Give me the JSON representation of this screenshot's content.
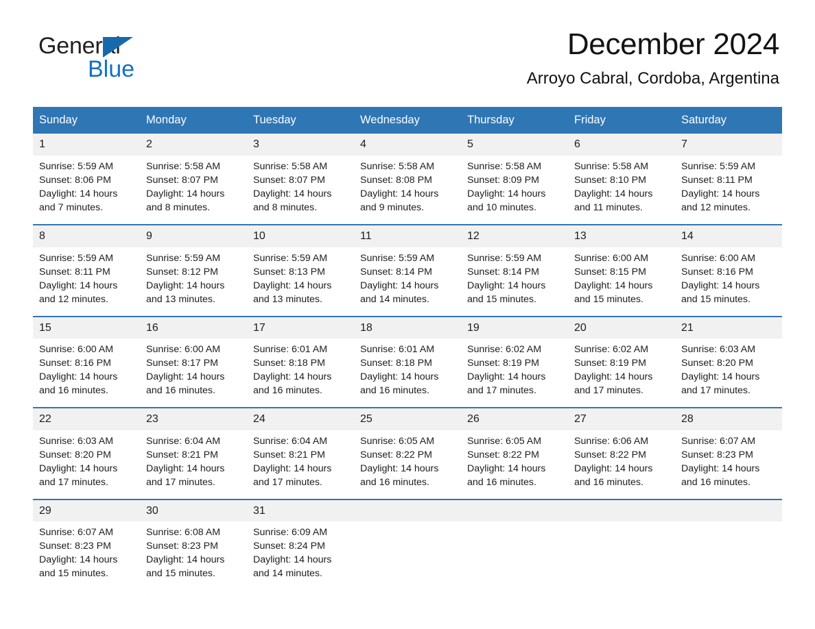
{
  "brand": {
    "name_part1": "General",
    "name_part2": "Blue",
    "logo_icon": "triangle-logo-icon",
    "accent_color": "#1271c4"
  },
  "header": {
    "month_title": "December 2024",
    "location": "Arroyo Cabral, Cordoba, Argentina"
  },
  "theme": {
    "header_blue": "#2f76b5",
    "daynum_band": "#f1f1f1",
    "text": "#1c1c1c"
  },
  "calendar": {
    "day_headers": [
      "Sunday",
      "Monday",
      "Tuesday",
      "Wednesday",
      "Thursday",
      "Friday",
      "Saturday"
    ],
    "weeks": [
      [
        {
          "day": "1",
          "sunrise": "Sunrise: 5:59 AM",
          "sunset": "Sunset: 8:06 PM",
          "daylight_line1": "Daylight: 14 hours",
          "daylight_line2": "and 7 minutes."
        },
        {
          "day": "2",
          "sunrise": "Sunrise: 5:58 AM",
          "sunset": "Sunset: 8:07 PM",
          "daylight_line1": "Daylight: 14 hours",
          "daylight_line2": "and 8 minutes."
        },
        {
          "day": "3",
          "sunrise": "Sunrise: 5:58 AM",
          "sunset": "Sunset: 8:07 PM",
          "daylight_line1": "Daylight: 14 hours",
          "daylight_line2": "and 8 minutes."
        },
        {
          "day": "4",
          "sunrise": "Sunrise: 5:58 AM",
          "sunset": "Sunset: 8:08 PM",
          "daylight_line1": "Daylight: 14 hours",
          "daylight_line2": "and 9 minutes."
        },
        {
          "day": "5",
          "sunrise": "Sunrise: 5:58 AM",
          "sunset": "Sunset: 8:09 PM",
          "daylight_line1": "Daylight: 14 hours",
          "daylight_line2": "and 10 minutes."
        },
        {
          "day": "6",
          "sunrise": "Sunrise: 5:58 AM",
          "sunset": "Sunset: 8:10 PM",
          "daylight_line1": "Daylight: 14 hours",
          "daylight_line2": "and 11 minutes."
        },
        {
          "day": "7",
          "sunrise": "Sunrise: 5:59 AM",
          "sunset": "Sunset: 8:11 PM",
          "daylight_line1": "Daylight: 14 hours",
          "daylight_line2": "and 12 minutes."
        }
      ],
      [
        {
          "day": "8",
          "sunrise": "Sunrise: 5:59 AM",
          "sunset": "Sunset: 8:11 PM",
          "daylight_line1": "Daylight: 14 hours",
          "daylight_line2": "and 12 minutes."
        },
        {
          "day": "9",
          "sunrise": "Sunrise: 5:59 AM",
          "sunset": "Sunset: 8:12 PM",
          "daylight_line1": "Daylight: 14 hours",
          "daylight_line2": "and 13 minutes."
        },
        {
          "day": "10",
          "sunrise": "Sunrise: 5:59 AM",
          "sunset": "Sunset: 8:13 PM",
          "daylight_line1": "Daylight: 14 hours",
          "daylight_line2": "and 13 minutes."
        },
        {
          "day": "11",
          "sunrise": "Sunrise: 5:59 AM",
          "sunset": "Sunset: 8:14 PM",
          "daylight_line1": "Daylight: 14 hours",
          "daylight_line2": "and 14 minutes."
        },
        {
          "day": "12",
          "sunrise": "Sunrise: 5:59 AM",
          "sunset": "Sunset: 8:14 PM",
          "daylight_line1": "Daylight: 14 hours",
          "daylight_line2": "and 15 minutes."
        },
        {
          "day": "13",
          "sunrise": "Sunrise: 6:00 AM",
          "sunset": "Sunset: 8:15 PM",
          "daylight_line1": "Daylight: 14 hours",
          "daylight_line2": "and 15 minutes."
        },
        {
          "day": "14",
          "sunrise": "Sunrise: 6:00 AM",
          "sunset": "Sunset: 8:16 PM",
          "daylight_line1": "Daylight: 14 hours",
          "daylight_line2": "and 15 minutes."
        }
      ],
      [
        {
          "day": "15",
          "sunrise": "Sunrise: 6:00 AM",
          "sunset": "Sunset: 8:16 PM",
          "daylight_line1": "Daylight: 14 hours",
          "daylight_line2": "and 16 minutes."
        },
        {
          "day": "16",
          "sunrise": "Sunrise: 6:00 AM",
          "sunset": "Sunset: 8:17 PM",
          "daylight_line1": "Daylight: 14 hours",
          "daylight_line2": "and 16 minutes."
        },
        {
          "day": "17",
          "sunrise": "Sunrise: 6:01 AM",
          "sunset": "Sunset: 8:18 PM",
          "daylight_line1": "Daylight: 14 hours",
          "daylight_line2": "and 16 minutes."
        },
        {
          "day": "18",
          "sunrise": "Sunrise: 6:01 AM",
          "sunset": "Sunset: 8:18 PM",
          "daylight_line1": "Daylight: 14 hours",
          "daylight_line2": "and 16 minutes."
        },
        {
          "day": "19",
          "sunrise": "Sunrise: 6:02 AM",
          "sunset": "Sunset: 8:19 PM",
          "daylight_line1": "Daylight: 14 hours",
          "daylight_line2": "and 17 minutes."
        },
        {
          "day": "20",
          "sunrise": "Sunrise: 6:02 AM",
          "sunset": "Sunset: 8:19 PM",
          "daylight_line1": "Daylight: 14 hours",
          "daylight_line2": "and 17 minutes."
        },
        {
          "day": "21",
          "sunrise": "Sunrise: 6:03 AM",
          "sunset": "Sunset: 8:20 PM",
          "daylight_line1": "Daylight: 14 hours",
          "daylight_line2": "and 17 minutes."
        }
      ],
      [
        {
          "day": "22",
          "sunrise": "Sunrise: 6:03 AM",
          "sunset": "Sunset: 8:20 PM",
          "daylight_line1": "Daylight: 14 hours",
          "daylight_line2": "and 17 minutes."
        },
        {
          "day": "23",
          "sunrise": "Sunrise: 6:04 AM",
          "sunset": "Sunset: 8:21 PM",
          "daylight_line1": "Daylight: 14 hours",
          "daylight_line2": "and 17 minutes."
        },
        {
          "day": "24",
          "sunrise": "Sunrise: 6:04 AM",
          "sunset": "Sunset: 8:21 PM",
          "daylight_line1": "Daylight: 14 hours",
          "daylight_line2": "and 17 minutes."
        },
        {
          "day": "25",
          "sunrise": "Sunrise: 6:05 AM",
          "sunset": "Sunset: 8:22 PM",
          "daylight_line1": "Daylight: 14 hours",
          "daylight_line2": "and 16 minutes."
        },
        {
          "day": "26",
          "sunrise": "Sunrise: 6:05 AM",
          "sunset": "Sunset: 8:22 PM",
          "daylight_line1": "Daylight: 14 hours",
          "daylight_line2": "and 16 minutes."
        },
        {
          "day": "27",
          "sunrise": "Sunrise: 6:06 AM",
          "sunset": "Sunset: 8:22 PM",
          "daylight_line1": "Daylight: 14 hours",
          "daylight_line2": "and 16 minutes."
        },
        {
          "day": "28",
          "sunrise": "Sunrise: 6:07 AM",
          "sunset": "Sunset: 8:23 PM",
          "daylight_line1": "Daylight: 14 hours",
          "daylight_line2": "and 16 minutes."
        }
      ],
      [
        {
          "day": "29",
          "sunrise": "Sunrise: 6:07 AM",
          "sunset": "Sunset: 8:23 PM",
          "daylight_line1": "Daylight: 14 hours",
          "daylight_line2": "and 15 minutes."
        },
        {
          "day": "30",
          "sunrise": "Sunrise: 6:08 AM",
          "sunset": "Sunset: 8:23 PM",
          "daylight_line1": "Daylight: 14 hours",
          "daylight_line2": "and 15 minutes."
        },
        {
          "day": "31",
          "sunrise": "Sunrise: 6:09 AM",
          "sunset": "Sunset: 8:24 PM",
          "daylight_line1": "Daylight: 14 hours",
          "daylight_line2": "and 14 minutes."
        },
        {
          "day": "",
          "sunrise": "",
          "sunset": "",
          "daylight_line1": "",
          "daylight_line2": ""
        },
        {
          "day": "",
          "sunrise": "",
          "sunset": "",
          "daylight_line1": "",
          "daylight_line2": ""
        },
        {
          "day": "",
          "sunrise": "",
          "sunset": "",
          "daylight_line1": "",
          "daylight_line2": ""
        },
        {
          "day": "",
          "sunrise": "",
          "sunset": "",
          "daylight_line1": "",
          "daylight_line2": ""
        }
      ]
    ]
  }
}
